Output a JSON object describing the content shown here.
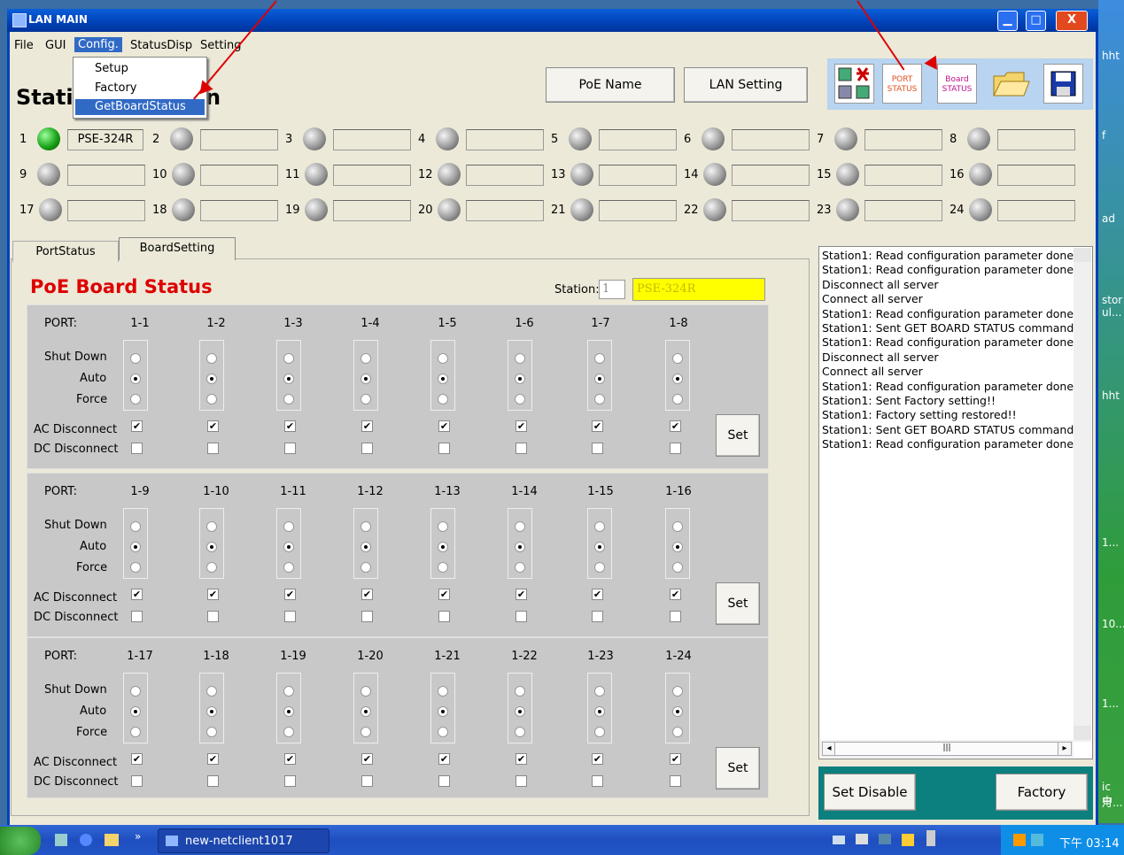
{
  "window": {
    "title": "LAN MAIN",
    "min": "▁",
    "max": "□",
    "close": "X"
  },
  "menu": {
    "items": [
      "File",
      "GUI",
      "Config.",
      "StatusDisp",
      "Setting"
    ]
  },
  "dropdown": {
    "items": [
      "Setup",
      "Factory",
      "GetBoardStatus"
    ]
  },
  "background_title": {
    "left": "Stati",
    "right": "n"
  },
  "top_buttons": {
    "poe_name": "PoE Name",
    "lan_setting": "LAN Setting"
  },
  "toolbar": {
    "port_status": "PORT STATUS",
    "board_status": "Board STATUS"
  },
  "stations": [
    {
      "n": "1",
      "name": "PSE-324R",
      "on": true
    },
    {
      "n": "2",
      "name": ""
    },
    {
      "n": "3",
      "name": ""
    },
    {
      "n": "4",
      "name": ""
    },
    {
      "n": "5",
      "name": ""
    },
    {
      "n": "6",
      "name": ""
    },
    {
      "n": "7",
      "name": ""
    },
    {
      "n": "8",
      "name": ""
    },
    {
      "n": "9",
      "name": ""
    },
    {
      "n": "10",
      "name": ""
    },
    {
      "n": "11",
      "name": ""
    },
    {
      "n": "12",
      "name": ""
    },
    {
      "n": "13",
      "name": ""
    },
    {
      "n": "14",
      "name": ""
    },
    {
      "n": "15",
      "name": ""
    },
    {
      "n": "16",
      "name": ""
    },
    {
      "n": "17",
      "name": ""
    },
    {
      "n": "18",
      "name": ""
    },
    {
      "n": "19",
      "name": ""
    },
    {
      "n": "20",
      "name": ""
    },
    {
      "n": "21",
      "name": ""
    },
    {
      "n": "22",
      "name": ""
    },
    {
      "n": "23",
      "name": ""
    },
    {
      "n": "24",
      "name": ""
    }
  ],
  "tabs": [
    "PortStatus",
    "BoardSetting"
  ],
  "board": {
    "title": "PoE Board Status",
    "station_label": "Station:",
    "station_value": "1",
    "station_name": "PSE-324R",
    "labels": {
      "port": "PORT:",
      "shut_down": "Shut Down",
      "auto": "Auto",
      "force": "Force",
      "ac": "AC Disconnect",
      "dc": "DC Disconnect",
      "set": "Set"
    },
    "panels": [
      {
        "ports": [
          "1-1",
          "1-2",
          "1-3",
          "1-4",
          "1-5",
          "1-6",
          "1-7",
          "1-8"
        ]
      },
      {
        "ports": [
          "1-9",
          "1-10",
          "1-11",
          "1-12",
          "1-13",
          "1-14",
          "1-15",
          "1-16"
        ]
      },
      {
        "ports": [
          "1-17",
          "1-18",
          "1-19",
          "1-20",
          "1-21",
          "1-22",
          "1-23",
          "1-24"
        ]
      }
    ],
    "mode": "Auto",
    "ac_disconnect": true,
    "dc_disconnect": false
  },
  "log": [
    "Station1: Read configuration parameter done!!",
    "Station1: Read configuration parameter done!!",
    "Disconnect all server",
    "Connect all server",
    "Station1: Read configuration parameter done!!",
    "Station1: Sent GET BOARD STATUS command",
    "Station1: Read configuration parameter done!!",
    "Disconnect all server",
    "Connect all server",
    "Station1: Read configuration parameter done!!",
    "Station1: Sent Factory setting!!",
    "Station1: Factory setting restored!!",
    "Station1: Sent GET BOARD STATUS command",
    "Station1: Read configuration parameter done!!"
  ],
  "bottom_buttons": {
    "set_disable": "Set Disable",
    "factory": "Factory"
  },
  "desktop": {
    "labels": [
      "hht",
      "f",
      "ad",
      "stor",
      "ul...",
      "hht",
      "1...",
      "10...",
      "1...",
      "ic 中",
      "月..."
    ]
  },
  "taskbar": {
    "item": "new-netclient1017",
    "clock": "下午 03:14",
    "more": "»"
  }
}
